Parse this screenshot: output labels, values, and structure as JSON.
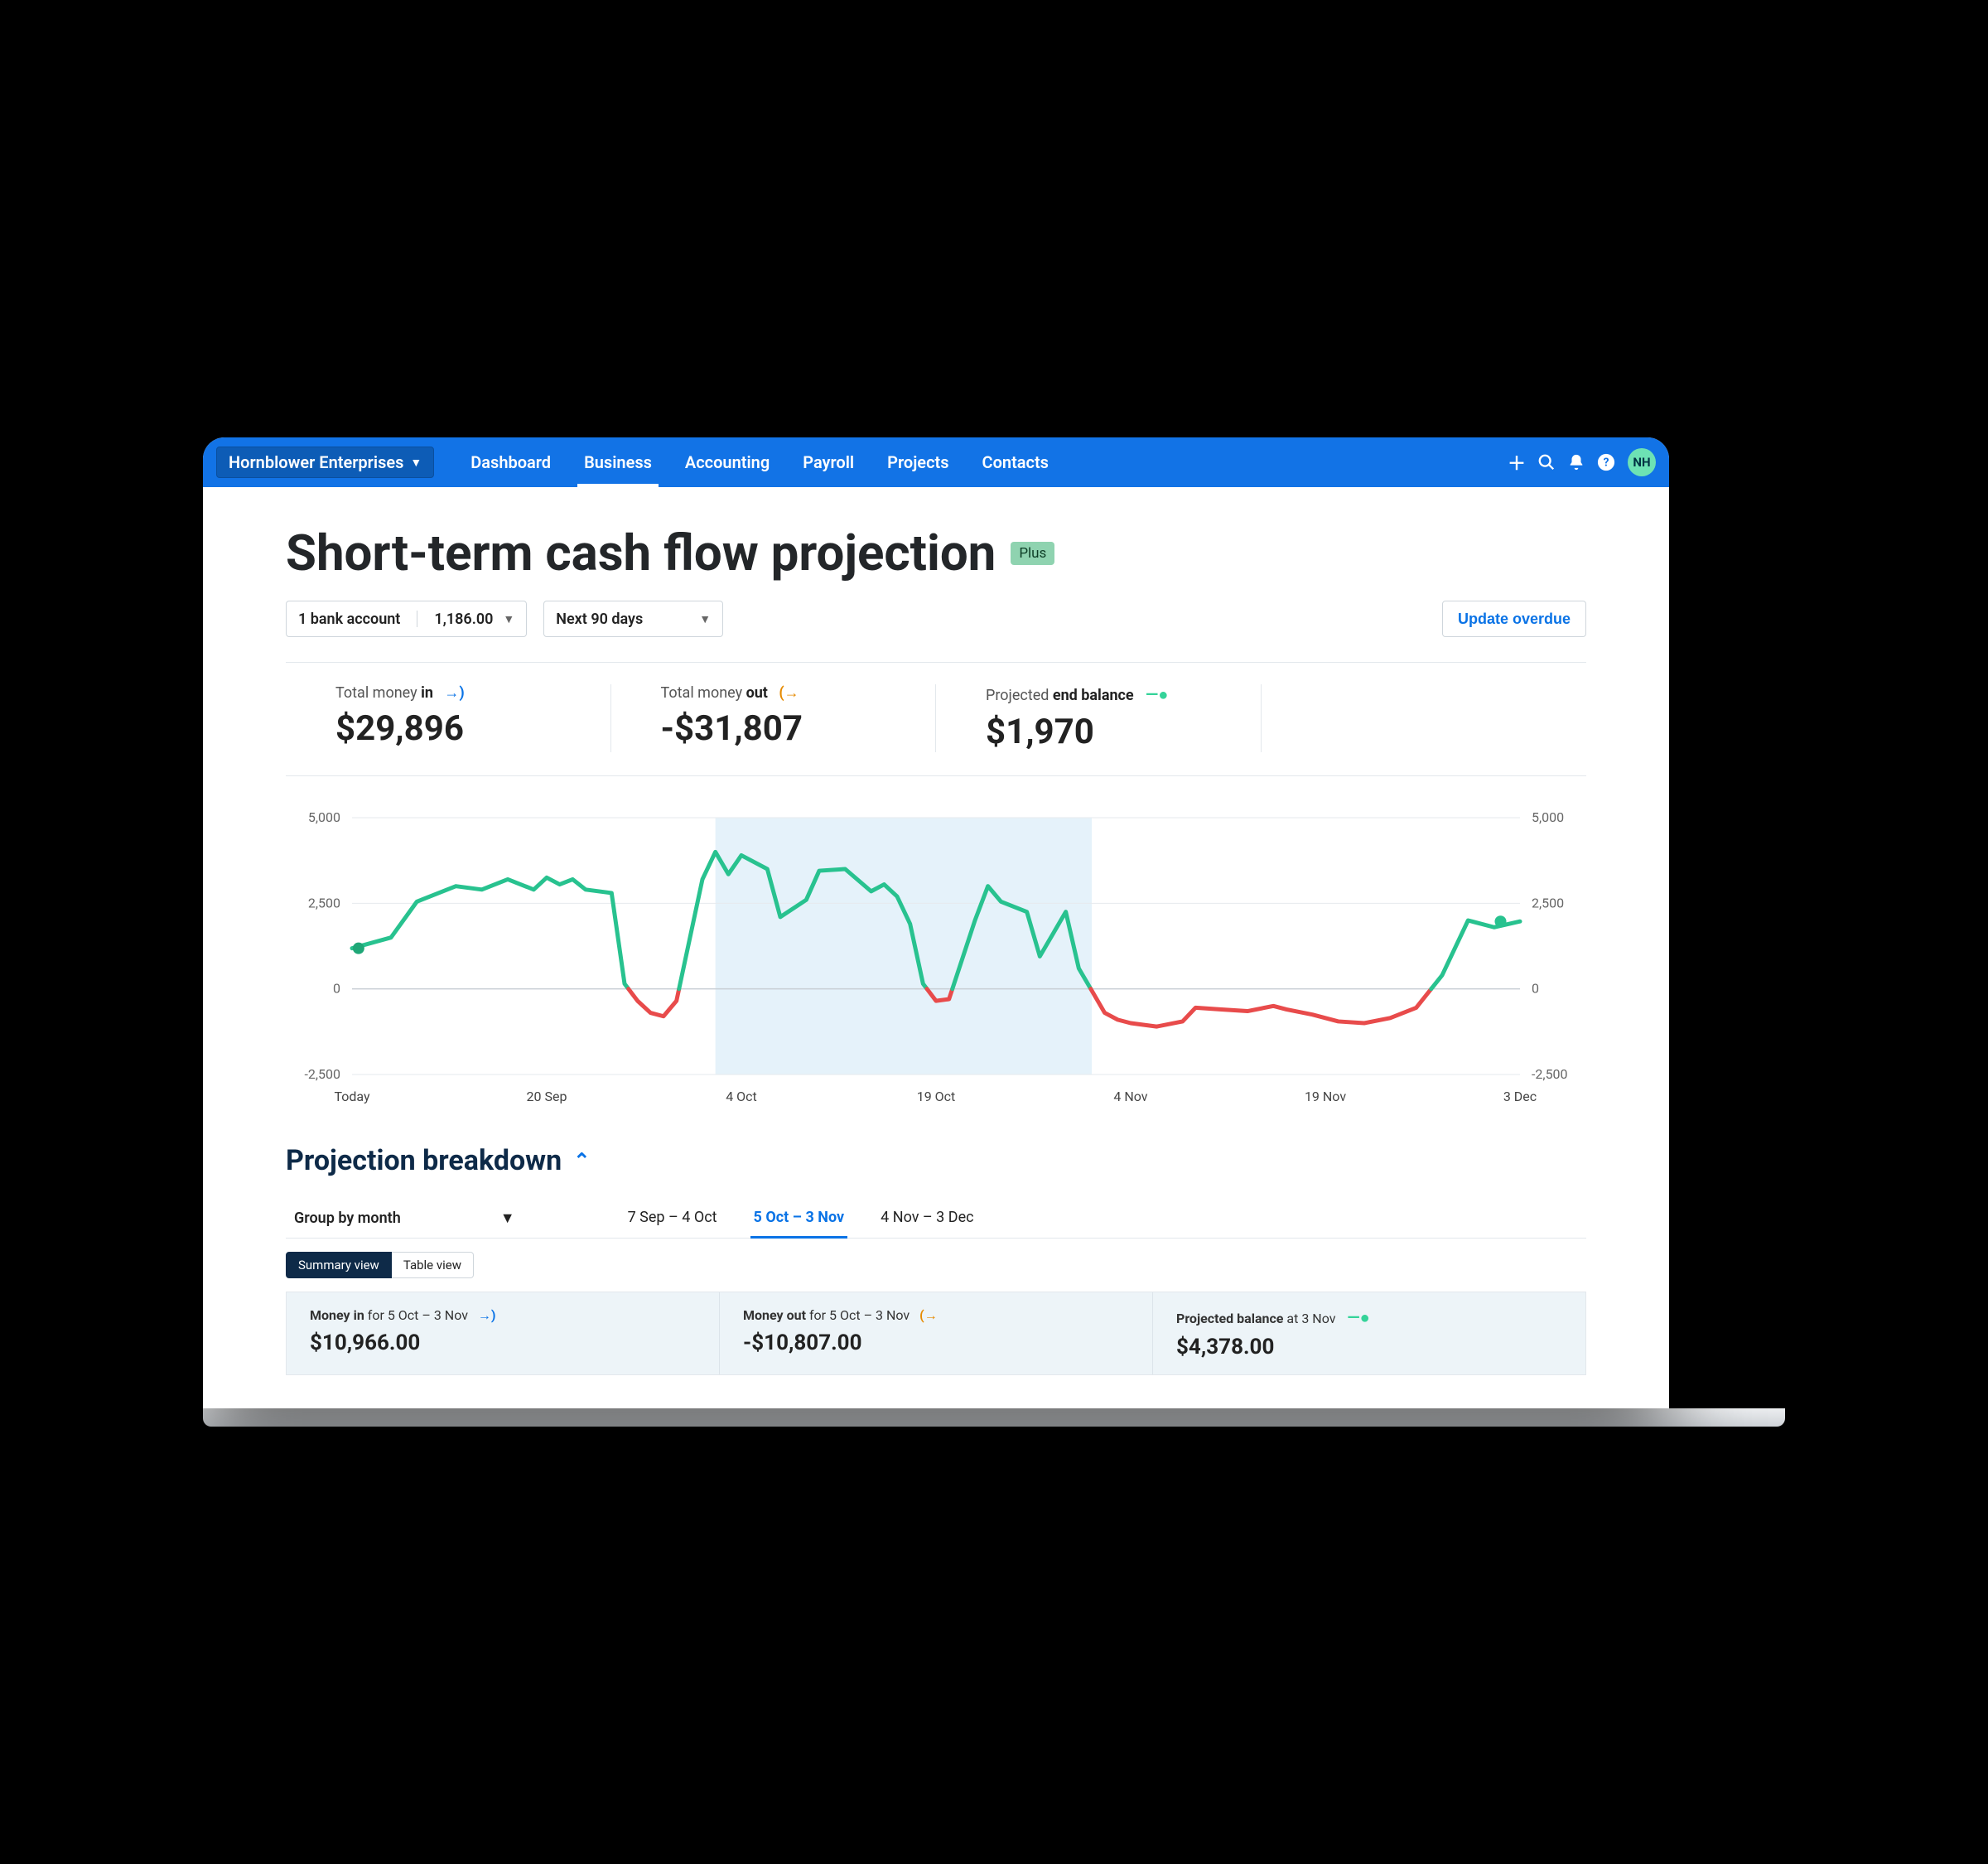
{
  "nav": {
    "org": "Hornblower Enterprises",
    "items": [
      "Dashboard",
      "Business",
      "Accounting",
      "Payroll",
      "Projects",
      "Contacts"
    ],
    "active_index": 1,
    "avatar_initials": "NH"
  },
  "page": {
    "title": "Short-term cash flow projection",
    "badge": "Plus",
    "account_select_label": "1 bank account",
    "account_select_value": "1,186.00",
    "range_select": "Next 90 days",
    "update_button": "Update overdue"
  },
  "summary": {
    "money_in": {
      "label_pre": "Total money ",
      "label_bold": "in",
      "value": "$29,896"
    },
    "money_out": {
      "label_pre": "Total money ",
      "label_bold": "out",
      "value": "-$31,807"
    },
    "end_balance": {
      "label_pre": "Projected ",
      "label_bold": "end balance",
      "value": "$1,970"
    }
  },
  "chart_data": {
    "type": "line",
    "ylabel": "",
    "ylim": [
      -2500,
      5000
    ],
    "y_ticks_left": [
      "5,000",
      "2,500",
      "0",
      "-2,500"
    ],
    "y_ticks_right": [
      "5,000",
      "2,500",
      "0",
      "-2,500"
    ],
    "x_ticks": [
      "Today",
      "20 Sep",
      "4 Oct",
      "19 Oct",
      "4 Nov",
      "19 Nov",
      "3 Dec"
    ],
    "selection_band": {
      "from": "5 Oct",
      "to": "3 Nov"
    },
    "start_dot": {
      "x_index": 0.5,
      "value": 1186
    },
    "end_dot": {
      "x_index": 88.5,
      "value": 1970
    },
    "series": [
      {
        "name": "Projected balance",
        "x": [
          0,
          3,
          5,
          8,
          10,
          12,
          14,
          15,
          16,
          17,
          18,
          20,
          21,
          22,
          23,
          24,
          25,
          27,
          28,
          29,
          30,
          32,
          33,
          35,
          36,
          38,
          40,
          41,
          42,
          43,
          44,
          45,
          46,
          48,
          49,
          50,
          52,
          53,
          55,
          56,
          58,
          59,
          60,
          62,
          64,
          65,
          67,
          69,
          71,
          72,
          74,
          76,
          78,
          80,
          82,
          84,
          86,
          88,
          90
        ],
        "values": [
          1186,
          1500,
          2550,
          3000,
          2900,
          3200,
          2900,
          3250,
          3050,
          3200,
          2900,
          2800,
          150,
          -350,
          -700,
          -800,
          -350,
          3200,
          4000,
          3350,
          3900,
          3500,
          2100,
          2600,
          3450,
          3500,
          2850,
          3050,
          2700,
          1900,
          150,
          -350,
          -300,
          2000,
          3000,
          2550,
          2250,
          950,
          2250,
          600,
          -700,
          -900,
          -1000,
          -1100,
          -950,
          -550,
          -600,
          -650,
          -500,
          -600,
          -750,
          -950,
          -1000,
          -850,
          -550,
          400,
          2000,
          1800,
          1970
        ]
      }
    ]
  },
  "breakdown": {
    "heading": "Projection breakdown",
    "group_by_label": "Group by month",
    "tabs": [
      "7 Sep – 4 Oct",
      "5 Oct – 3 Nov",
      "4 Nov – 3 Dec"
    ],
    "active_tab": 1,
    "view_toggle": {
      "options": [
        "Summary view",
        "Table view"
      ],
      "selected": 0
    },
    "cards": {
      "money_in": {
        "label_bold": "Money in",
        "label_rest": " for 5 Oct – 3 Nov",
        "value": "$10,966.00"
      },
      "money_out": {
        "label_bold": "Money out",
        "label_rest": " for 5 Oct – 3 Nov",
        "value": "-$10,807.00"
      },
      "balance": {
        "label_bold": "Projected balance",
        "label_rest": " at 3 Nov",
        "value": "$4,378.00"
      }
    }
  }
}
